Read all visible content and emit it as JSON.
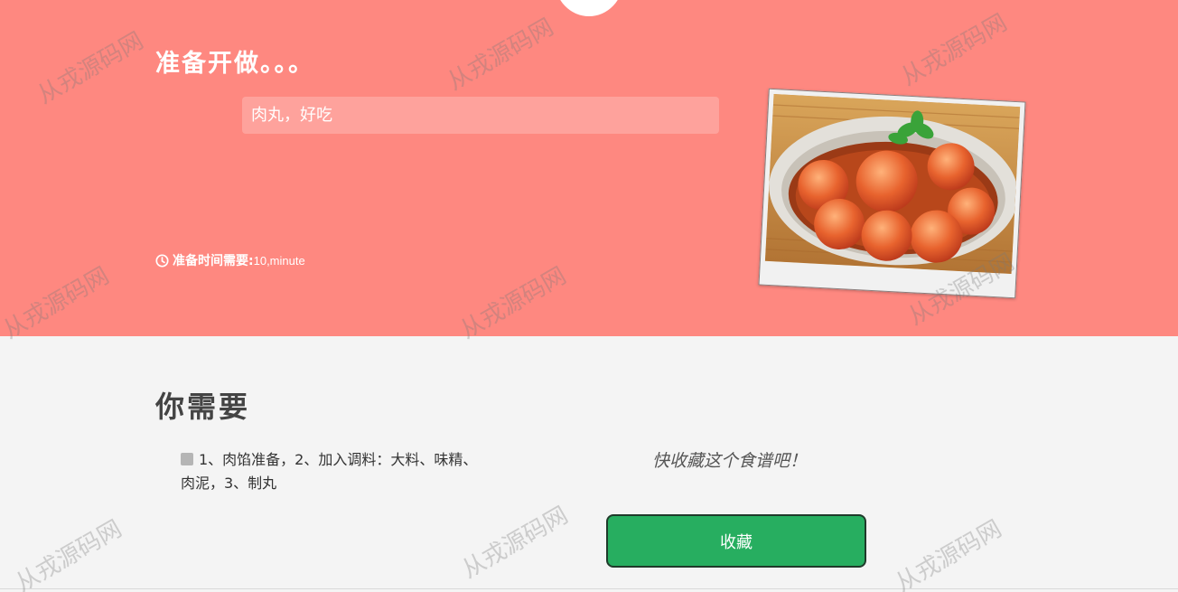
{
  "hero": {
    "title": "准备开做。。。",
    "description": "肉丸，好吃",
    "prep_label": "准备时间需要:",
    "prep_value": "10,minute",
    "photo_alt": "肉丸"
  },
  "content": {
    "section_title": "你需要",
    "ingredients_text": "1、肉馅准备，2、加入调料：大料、味精、肉泥，3、制丸",
    "collect_prompt": "快收藏这个食谱吧！",
    "collect_button": "收藏"
  },
  "watermark": "从戎源码网",
  "icons": {
    "clock": "clock-icon"
  },
  "colors": {
    "hero_bg": "#fe8880",
    "content_bg": "#f4f4f4",
    "button_green": "#27ae60"
  }
}
